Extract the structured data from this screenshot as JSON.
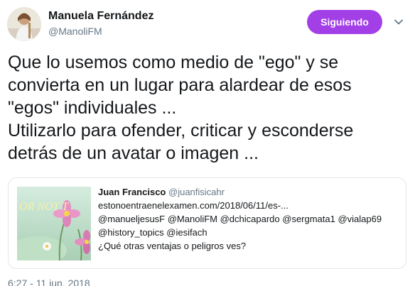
{
  "author": {
    "display_name": "Manuela Fernández",
    "handle": "@ManoliFM"
  },
  "follow_button": {
    "label": "Siguiendo",
    "color": "#a23fe6"
  },
  "tweet": {
    "lines": [
      "Que lo usemos como medio de \"ego\" y se",
      "convierta en un lugar para alardear de esos",
      "\"egos\" individuales ...",
      "Utilizarlo para ofender, criticar y esconderse",
      "detrás de un avatar o imagen ..."
    ]
  },
  "quoted_tweet": {
    "display_name": "Juan Francisco",
    "handle": "@juanfisicahr",
    "image_text": "OR NOT T",
    "lines": [
      "estonoentraenelexamen.com/2018/06/11/es-...",
      "@manueljesusF @ManoliFM @dchicapardo @sergmata1 @vialap69",
      "@history_topics @iesifach",
      "¿Qué otras ventajas o peligros ves?"
    ]
  },
  "timestamp": "6:27 - 11 jun. 2018",
  "icons": {
    "menu": "chevron-down-icon"
  },
  "colors": {
    "text": "#14171a",
    "secondary": "#657786",
    "border": "#e1e8ed"
  }
}
